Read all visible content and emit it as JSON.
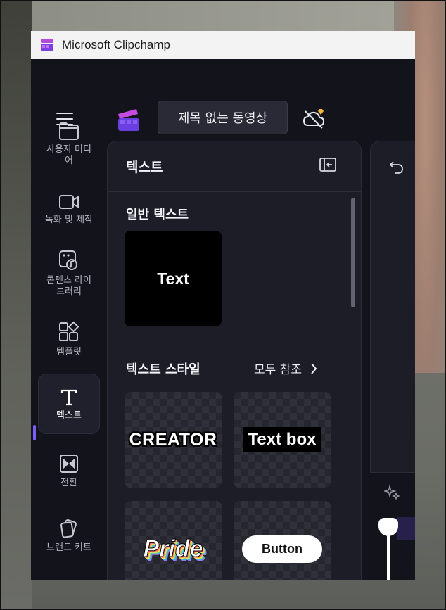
{
  "window": {
    "title": "Microsoft Clipchamp"
  },
  "header": {
    "project_title": "제목 없는 동영상"
  },
  "rail": {
    "items": [
      {
        "label": "사용자 미디\n어",
        "icon": "folder-icon"
      },
      {
        "label": "녹화 및 제작",
        "icon": "video-camera-icon"
      },
      {
        "label": "콘텐츠 라이\n브러리",
        "icon": "content-library-icon"
      },
      {
        "label": "템플릿",
        "icon": "templates-icon"
      },
      {
        "label": "텍스트",
        "icon": "text-icon",
        "active": true
      },
      {
        "label": "전환",
        "icon": "transition-icon"
      },
      {
        "label": "브랜드 키트",
        "icon": "brand-kit-icon"
      }
    ]
  },
  "panel": {
    "title": "텍스트",
    "plain_section": {
      "title": "일반 텍스트",
      "card_text": "Text"
    },
    "styles_section": {
      "title": "텍스트 스타일",
      "see_all": "모두 참조",
      "cards": [
        "CREATOR",
        "Text box",
        "Pride",
        "Button"
      ]
    }
  },
  "colors": {
    "accent": "#7b5cff",
    "background": "#13131c",
    "panel": "#1d1d28",
    "titlebar": "#f3f3f3"
  }
}
